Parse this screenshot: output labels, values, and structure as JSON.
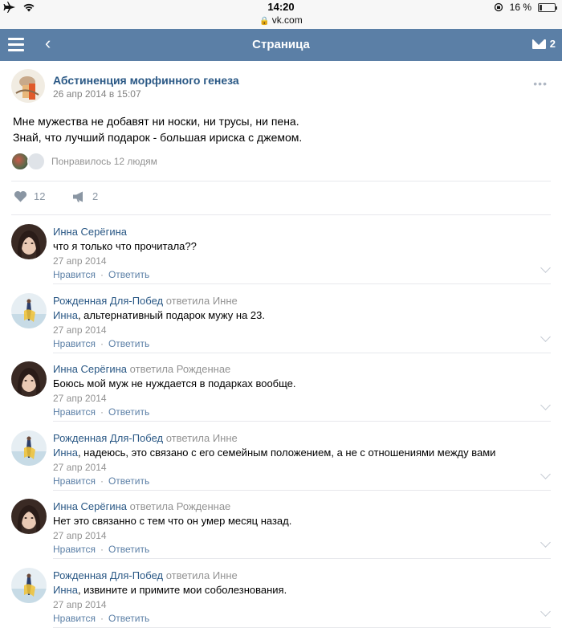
{
  "status_bar": {
    "time": "14:20",
    "url": "vk.com",
    "battery_text": "16 %",
    "battery_level": 0.16
  },
  "header": {
    "title": "Страница",
    "mail_count": "2",
    "icons": [
      "menu-icon",
      "back-icon",
      "mail-icon"
    ]
  },
  "post": {
    "author": "Абстиненция морфинного генеза",
    "date": "26 апр 2014 в 15:07",
    "text_lines": [
      "Мне мужества не добавят ни носки, ни трусы, ни пена.",
      "Знай, что лучший подарок - большая ириска с джемом."
    ],
    "liked_by": "Понравилось 12 людям",
    "likes": "12",
    "reposts": "2"
  },
  "comments": [
    {
      "author": "Инна Серёгина",
      "replied": "",
      "mention": "",
      "text": "что я только что прочитала??",
      "date": "27 апр 2014",
      "like": "Нравится",
      "reply": "Ответить"
    },
    {
      "author": "Рожденная Для-Побед",
      "replied": "ответила Инне",
      "mention": "Инна",
      "text": ", альтернативный подарок мужу на 23.",
      "date": "27 апр 2014",
      "like": "Нравится",
      "reply": "Ответить"
    },
    {
      "author": "Инна Серёгина",
      "replied": "ответила Рожденнае",
      "mention": "",
      "text": "Боюсь мой муж не нуждается в подарках вообще.",
      "date": "27 апр 2014",
      "like": "Нравится",
      "reply": "Ответить"
    },
    {
      "author": "Рожденная Для-Побед",
      "replied": "ответила Инне",
      "mention": "Инна",
      "text": ", надеюсь, это связано с его семейным положением, а не с отношениями между вами",
      "date": "27 апр 2014",
      "like": "Нравится",
      "reply": "Ответить"
    },
    {
      "author": "Инна Серёгина",
      "replied": "ответила Рожденнае",
      "mention": "",
      "text": "Нет это связанно с тем что он умер месяц назад.",
      "date": "27 апр 2014",
      "like": "Нравится",
      "reply": "Ответить"
    },
    {
      "author": "Рожденная Для-Побед",
      "replied": "ответила Инне",
      "mention": "Инна",
      "text": ", извините и примите мои соболезнования.",
      "date": "27 апр 2014",
      "like": "Нравится",
      "reply": "Ответить"
    }
  ],
  "colors": {
    "header_bg": "#5b7fa6",
    "link": "#2a5885",
    "muted": "#939393"
  }
}
